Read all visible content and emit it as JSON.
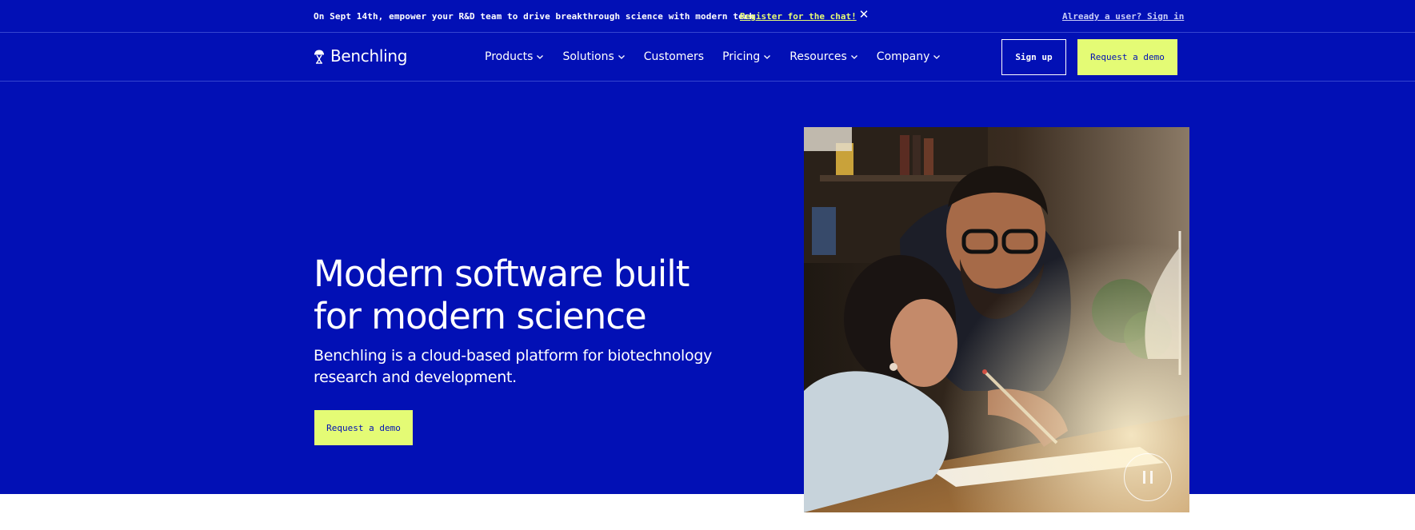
{
  "announcement": {
    "text": "On Sept 14th, empower your R&D team to drive breakthrough science with modern tech",
    "link_label": "Register for the chat!",
    "close_glyph": "✕",
    "signin_label": "Already a user? Sign in"
  },
  "nav": {
    "logo_text": "Benchling",
    "items": [
      {
        "label": "Products",
        "has_dropdown": true
      },
      {
        "label": "Solutions",
        "has_dropdown": true
      },
      {
        "label": "Customers",
        "has_dropdown": false
      },
      {
        "label": "Pricing",
        "has_dropdown": true
      },
      {
        "label": "Resources",
        "has_dropdown": true
      },
      {
        "label": "Company",
        "has_dropdown": true
      }
    ],
    "signup_label": "Sign up",
    "demo_label": "Request a demo"
  },
  "hero": {
    "title": "Modern software built for modern science",
    "subtitle": "Benchling is a cloud-based platform for biotechnology research and development.",
    "cta_label": "Request a demo"
  },
  "colors": {
    "brand_blue": "#0210b5",
    "accent_yellow": "#e4fb75",
    "white": "#ffffff"
  },
  "icons": {
    "logo": "jellyfish-logo-icon",
    "dropdown": "chevron-down-icon",
    "close": "close-icon",
    "pause": "pause-icon"
  }
}
